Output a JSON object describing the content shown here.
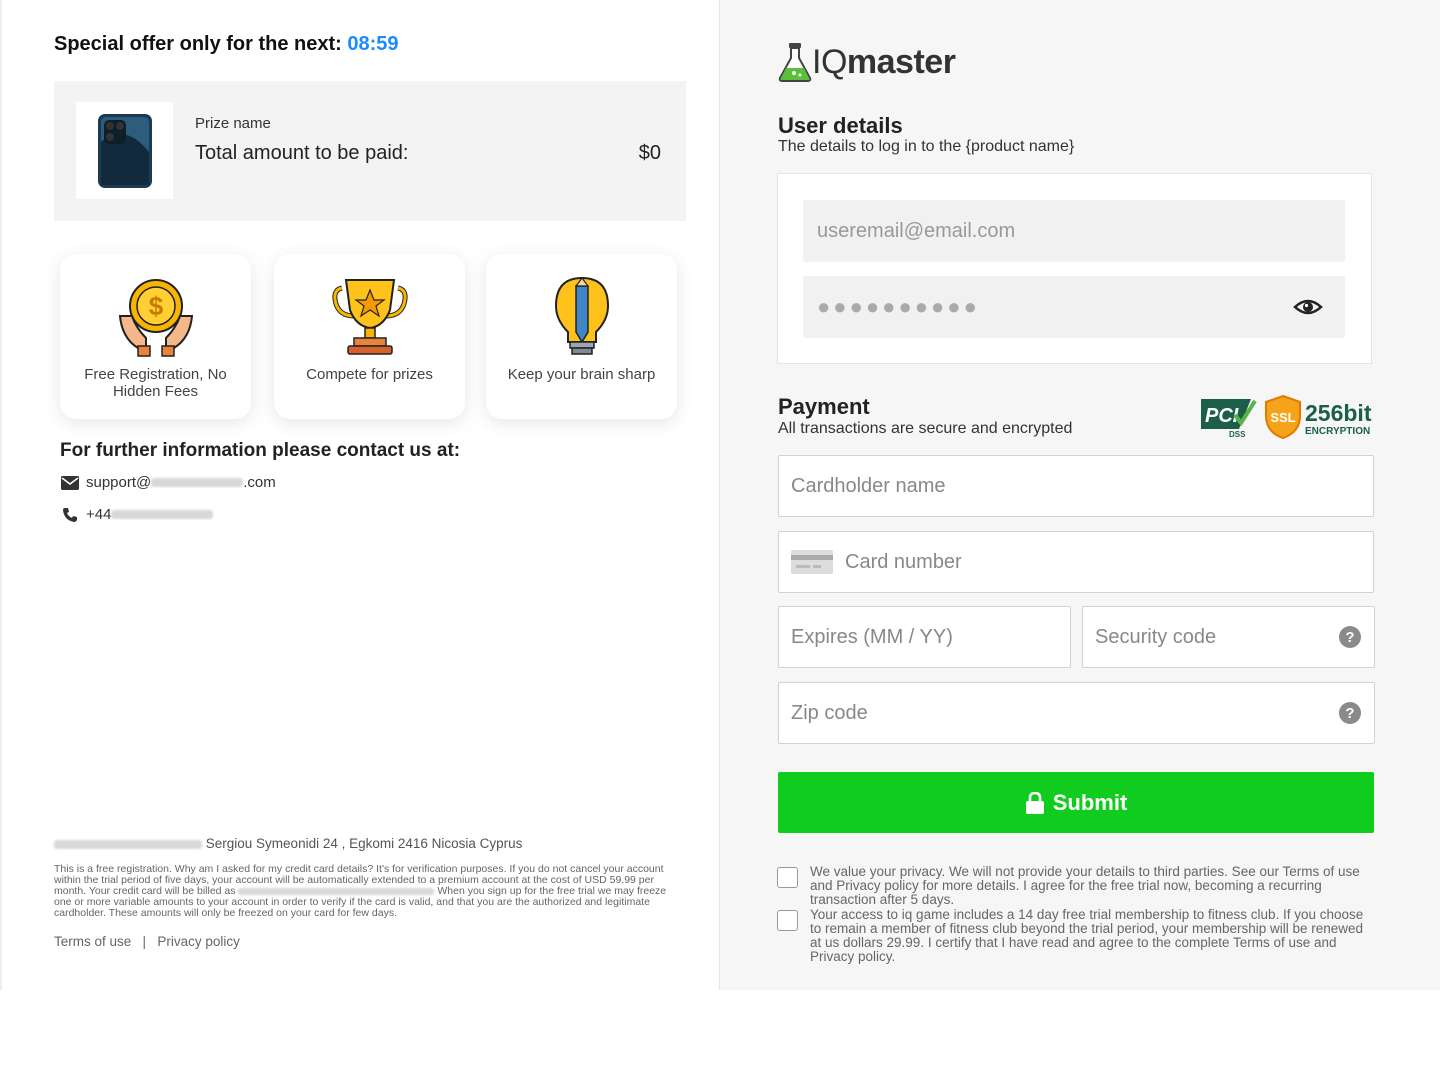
{
  "left": {
    "offer_label": "Special offer only for the next:",
    "offer_timer": "08:59",
    "prize": {
      "name": "Prize name",
      "total_label": "Total amount to be paid:",
      "amount": "$0"
    },
    "features": [
      {
        "icon": "coin-hands-icon",
        "label": "Free Registration, No Hidden Fees"
      },
      {
        "icon": "trophy-icon",
        "label": "Compete for prizes"
      },
      {
        "icon": "lightbulb-pencil-icon",
        "label": "Keep your brain sharp"
      }
    ],
    "contact": {
      "title": "For further information please contact us at:",
      "email_prefix": "support@",
      "email_suffix": ".com",
      "phone_prefix": "+44"
    },
    "footer": {
      "address": "Sergiou Symeonidi 24 , Egkomi 2416 Nicosia Cyprus",
      "fineprint_1": "This is a free registration. Why am I asked for my credit card details? It's for verification purposes. If you do not cancel your account within the trial period of five days, your account will be automatically extended to a premium account at the cost of USD 59.99 per month. Your credit card will be billed as",
      "fineprint_2": "When you sign up for the free trial we may freeze one or more variable amounts to your account in order to verify if the card is valid, and that you are the authorized and legitimate cardholder. These amounts will only be freezed on your card for few days.",
      "terms": "Terms of use",
      "separator": "|",
      "privacy": "Privacy policy"
    }
  },
  "right": {
    "logo": {
      "iq": "IQ",
      "master": "master"
    },
    "user_details": {
      "title": "User details",
      "subtitle": "The details to log in to the {product name}",
      "email_placeholder": "useremail@email.com",
      "password_mask": "●●●●●●●●●●"
    },
    "payment": {
      "title": "Payment",
      "subtitle": "All transactions are secure and encrypted",
      "badges": {
        "pci": "PCI",
        "dss": "DSS",
        "ssl": "SSL",
        "bits": "256bit",
        "encryption": "ENCRYPTION"
      },
      "cardholder_placeholder": "Cardholder name",
      "card_number_placeholder": "Card number",
      "expiry_placeholder": "Expires (MM / YY)",
      "security_placeholder": "Security code",
      "zip_placeholder": "Zip code",
      "help": "?"
    },
    "submit_label": "Submit",
    "consents": [
      "We value your privacy. We will not provide your details to third parties. See our Terms of use and Privacy policy for more details. I agree for the free trial now, becoming a recurring transaction after 5 days.",
      "Your access to iq game includes a 14 day free trial membership to fitness club. If you choose to remain a member of fitness club beyond the trial period, your membership will be renewed at us dollars 29.99. I certify that I have read and agree to the complete Terms of use and Privacy policy."
    ]
  },
  "colors": {
    "timer": "#1a8cff",
    "submit": "#10cc1e",
    "panel": "#f6f6f6"
  }
}
